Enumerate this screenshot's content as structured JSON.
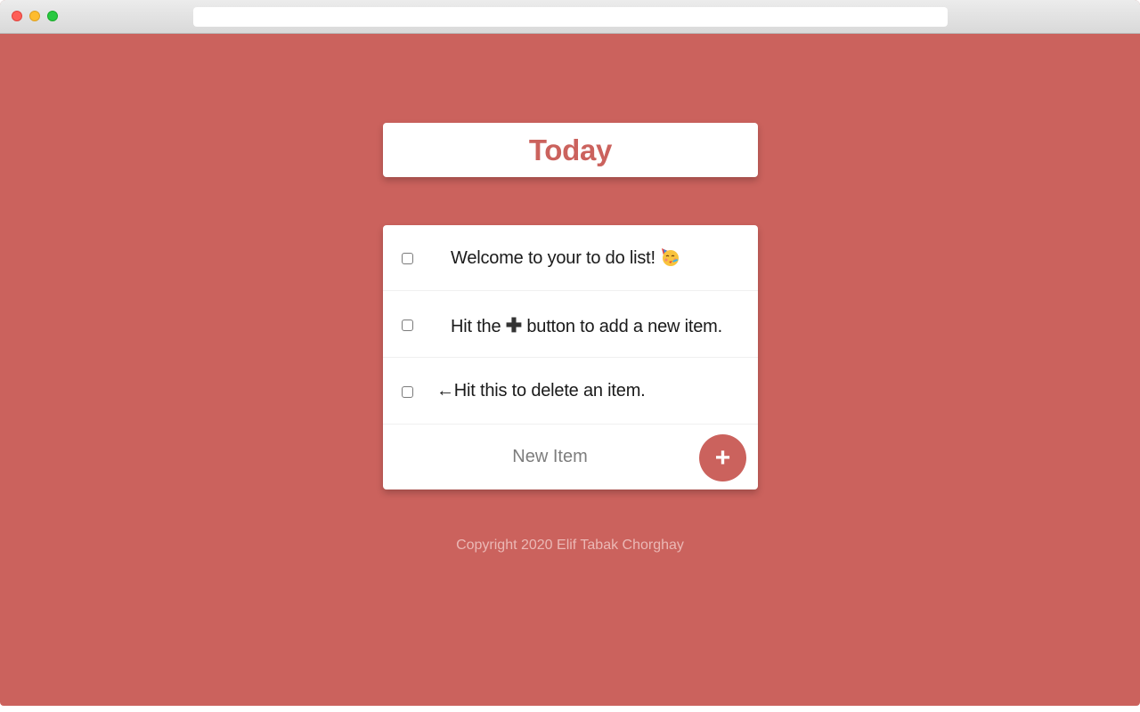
{
  "colors": {
    "background": "#cb625d",
    "accent": "#cb625d",
    "card": "#ffffff",
    "footer_text": "#ebb8b5"
  },
  "heading": {
    "title": "Today"
  },
  "items": [
    {
      "before": "Welcome to your to do list! ",
      "icon": "party-face-emoji",
      "after": "",
      "checked": false
    },
    {
      "before": "Hit the ",
      "icon": "plus-icon",
      "icon_glyph": "✚",
      "after": " button to add a new item.",
      "checked": false
    },
    {
      "before": "←Hit this to delete an item.",
      "icon": "",
      "after": "",
      "checked": false
    }
  ],
  "new_item": {
    "placeholder": "New Item",
    "value": "",
    "button_label": "+"
  },
  "footer": {
    "text": "Copyright 2020 Elif Tabak Chorghay"
  }
}
